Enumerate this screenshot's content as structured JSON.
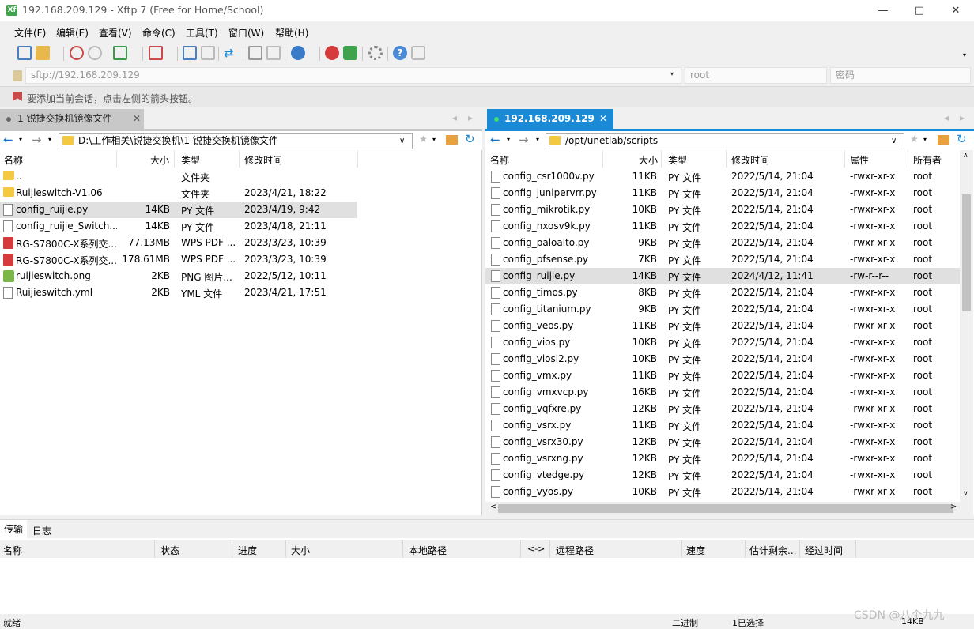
{
  "window": {
    "title": "192.168.209.129 - Xftp 7 (Free for Home/School)",
    "app_icon": "xftp-icon"
  },
  "menu": [
    "文件(F)",
    "编辑(E)",
    "查看(V)",
    "命令(C)",
    "工具(T)",
    "窗口(W)",
    "帮助(H)"
  ],
  "address": {
    "url": "sftp://192.168.209.129",
    "user": "root",
    "password_placeholder": "密码"
  },
  "hint": "要添加当前会话，点击左侧的箭头按钮。",
  "left": {
    "tab": "1 锐捷交换机镜像文件",
    "path": "D:\\工作相关\\锐捷交换机\\1 锐捷交换机镜像文件",
    "columns": [
      "名称",
      "大小",
      "类型",
      "修改时间"
    ],
    "files": [
      {
        "icon": "folder",
        "name": "..",
        "size": "",
        "type": "文件夹",
        "mtime": ""
      },
      {
        "icon": "folder",
        "name": "Ruijieswitch-V1.06",
        "size": "",
        "type": "文件夹",
        "mtime": "2023/4/21, 18:22"
      },
      {
        "icon": "file",
        "name": "config_ruijie.py",
        "size": "14KB",
        "type": "PY 文件",
        "mtime": "2023/4/19, 9:42",
        "selected": true
      },
      {
        "icon": "file",
        "name": "config_ruijie_Switch....",
        "size": "14KB",
        "type": "PY 文件",
        "mtime": "2023/4/18, 21:11"
      },
      {
        "icon": "pdf",
        "name": "RG-S7800C-X系列交...",
        "size": "77.13MB",
        "type": "WPS PDF ...",
        "mtime": "2023/3/23, 10:39"
      },
      {
        "icon": "pdf",
        "name": "RG-S7800C-X系列交...",
        "size": "178.61MB",
        "type": "WPS PDF ...",
        "mtime": "2023/3/23, 10:39"
      },
      {
        "icon": "png",
        "name": "ruijieswitch.png",
        "size": "2KB",
        "type": "PNG 图片...",
        "mtime": "2022/5/12, 10:11"
      },
      {
        "icon": "file",
        "name": "Ruijieswitch.yml",
        "size": "2KB",
        "type": "YML 文件",
        "mtime": "2023/4/21, 17:51"
      }
    ]
  },
  "right": {
    "tab": "192.168.209.129",
    "path": "/opt/unetlab/scripts",
    "columns": [
      "名称",
      "大小",
      "类型",
      "修改时间",
      "属性",
      "所有者"
    ],
    "files": [
      {
        "name": "config_csr1000v.py",
        "size": "11KB",
        "type": "PY 文件",
        "mtime": "2022/5/14, 21:04",
        "perm": "-rwxr-xr-x",
        "owner": "root"
      },
      {
        "name": "config_junipervrr.py",
        "size": "11KB",
        "type": "PY 文件",
        "mtime": "2022/5/14, 21:04",
        "perm": "-rwxr-xr-x",
        "owner": "root"
      },
      {
        "name": "config_mikrotik.py",
        "size": "10KB",
        "type": "PY 文件",
        "mtime": "2022/5/14, 21:04",
        "perm": "-rwxr-xr-x",
        "owner": "root"
      },
      {
        "name": "config_nxosv9k.py",
        "size": "11KB",
        "type": "PY 文件",
        "mtime": "2022/5/14, 21:04",
        "perm": "-rwxr-xr-x",
        "owner": "root"
      },
      {
        "name": "config_paloalto.py",
        "size": "9KB",
        "type": "PY 文件",
        "mtime": "2022/5/14, 21:04",
        "perm": "-rwxr-xr-x",
        "owner": "root"
      },
      {
        "name": "config_pfsense.py",
        "size": "7KB",
        "type": "PY 文件",
        "mtime": "2022/5/14, 21:04",
        "perm": "-rwxr-xr-x",
        "owner": "root"
      },
      {
        "name": "config_ruijie.py",
        "size": "14KB",
        "type": "PY 文件",
        "mtime": "2024/4/12, 11:41",
        "perm": "-rw-r--r--",
        "owner": "root",
        "selected": true
      },
      {
        "name": "config_timos.py",
        "size": "8KB",
        "type": "PY 文件",
        "mtime": "2022/5/14, 21:04",
        "perm": "-rwxr-xr-x",
        "owner": "root"
      },
      {
        "name": "config_titanium.py",
        "size": "9KB",
        "type": "PY 文件",
        "mtime": "2022/5/14, 21:04",
        "perm": "-rwxr-xr-x",
        "owner": "root"
      },
      {
        "name": "config_veos.py",
        "size": "11KB",
        "type": "PY 文件",
        "mtime": "2022/5/14, 21:04",
        "perm": "-rwxr-xr-x",
        "owner": "root"
      },
      {
        "name": "config_vios.py",
        "size": "10KB",
        "type": "PY 文件",
        "mtime": "2022/5/14, 21:04",
        "perm": "-rwxr-xr-x",
        "owner": "root"
      },
      {
        "name": "config_viosl2.py",
        "size": "10KB",
        "type": "PY 文件",
        "mtime": "2022/5/14, 21:04",
        "perm": "-rwxr-xr-x",
        "owner": "root"
      },
      {
        "name": "config_vmx.py",
        "size": "11KB",
        "type": "PY 文件",
        "mtime": "2022/5/14, 21:04",
        "perm": "-rwxr-xr-x",
        "owner": "root"
      },
      {
        "name": "config_vmxvcp.py",
        "size": "16KB",
        "type": "PY 文件",
        "mtime": "2022/5/14, 21:04",
        "perm": "-rwxr-xr-x",
        "owner": "root"
      },
      {
        "name": "config_vqfxre.py",
        "size": "12KB",
        "type": "PY 文件",
        "mtime": "2022/5/14, 21:04",
        "perm": "-rwxr-xr-x",
        "owner": "root"
      },
      {
        "name": "config_vsrx.py",
        "size": "11KB",
        "type": "PY 文件",
        "mtime": "2022/5/14, 21:04",
        "perm": "-rwxr-xr-x",
        "owner": "root"
      },
      {
        "name": "config_vsrx30.py",
        "size": "12KB",
        "type": "PY 文件",
        "mtime": "2022/5/14, 21:04",
        "perm": "-rwxr-xr-x",
        "owner": "root"
      },
      {
        "name": "config_vsrxng.py",
        "size": "12KB",
        "type": "PY 文件",
        "mtime": "2022/5/14, 21:04",
        "perm": "-rwxr-xr-x",
        "owner": "root"
      },
      {
        "name": "config_vtedge.py",
        "size": "12KB",
        "type": "PY 文件",
        "mtime": "2022/5/14, 21:04",
        "perm": "-rwxr-xr-x",
        "owner": "root"
      },
      {
        "name": "config_vyos.py",
        "size": "10KB",
        "type": "PY 文件",
        "mtime": "2022/5/14, 21:04",
        "perm": "-rwxr-xr-x",
        "owner": "root"
      }
    ]
  },
  "bottom": {
    "tabs": [
      "传输",
      "日志"
    ],
    "columns": [
      "名称",
      "状态",
      "进度",
      "大小",
      "本地路径",
      "<->",
      "远程路径",
      "速度",
      "估计剩余...",
      "经过时间"
    ]
  },
  "status": {
    "ready": "就绪",
    "mode": "二进制",
    "selection": "1已选择",
    "size": "14KB",
    "watermark": "CSDN @八个九九"
  },
  "colors": {
    "tab_active": "#1a8ad6",
    "selected_row": "#e0e0e0",
    "folder": "#f5c842"
  }
}
